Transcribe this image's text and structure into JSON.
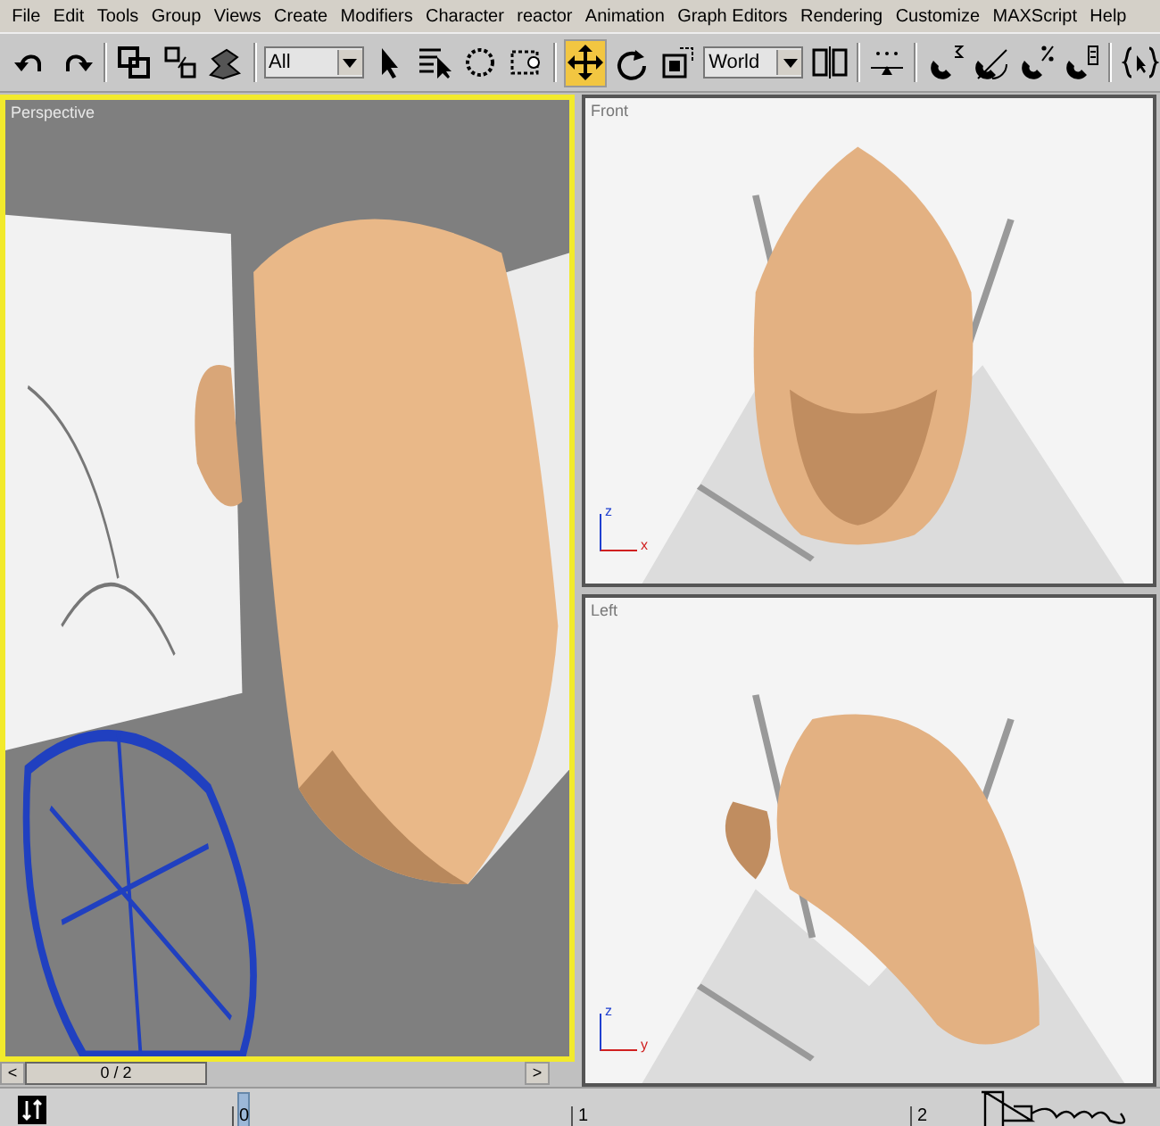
{
  "menu_bar": [
    "File",
    "Edit",
    "Tools",
    "Group",
    "Views",
    "Create",
    "Modifiers",
    "Character",
    "reactor",
    "Animation",
    "Graph Editors",
    "Rendering",
    "Customize",
    "MAXScript",
    "Help"
  ],
  "toolbar": [
    {
      "kind": "button",
      "selected": false
    },
    {
      "kind": "button",
      "selected": false
    },
    {
      "kind": "separator"
    },
    {
      "kind": "button",
      "selected": false
    },
    {
      "kind": "button",
      "selected": false
    },
    {
      "kind": "button",
      "selected": false
    },
    {
      "kind": "separator"
    },
    {
      "kind": "dropdown",
      "value": "All"
    },
    {
      "kind": "button",
      "selected": false
    },
    {
      "kind": "button",
      "selected": false
    },
    {
      "kind": "button",
      "selected": false
    },
    {
      "kind": "button",
      "selected": false
    },
    {
      "kind": "separator"
    },
    {
      "kind": "button",
      "selected": true
    },
    {
      "kind": "button",
      "selected": false
    },
    {
      "kind": "button",
      "selected": false
    },
    {
      "kind": "dropdown",
      "value": "World"
    },
    {
      "kind": "button",
      "selected": false
    },
    {
      "kind": "separator"
    },
    {
      "kind": "button",
      "selected": false
    },
    {
      "kind": "separator"
    },
    {
      "kind": "button",
      "selected": false
    },
    {
      "kind": "button",
      "selected": false
    },
    {
      "kind": "button",
      "selected": false
    },
    {
      "kind": "button",
      "selected": false
    },
    {
      "kind": "separator"
    },
    {
      "kind": "button",
      "selected": false
    }
  ],
  "viewports": [
    {
      "label": "Perspective",
      "selected": true,
      "kind": "perspective"
    },
    {
      "label": "Front",
      "selected": false,
      "kind": "front",
      "axes": [
        "z",
        "x"
      ]
    },
    {
      "label": "Left",
      "selected": false,
      "kind": "left",
      "axes": [
        "z",
        "y"
      ]
    }
  ],
  "time_slider": {
    "prev": "<",
    "frame": "0 / 2",
    "level": 0,
    "next": ">"
  },
  "track_bar": {
    "ticks": [
      "0",
      "1",
      "2"
    ]
  }
}
